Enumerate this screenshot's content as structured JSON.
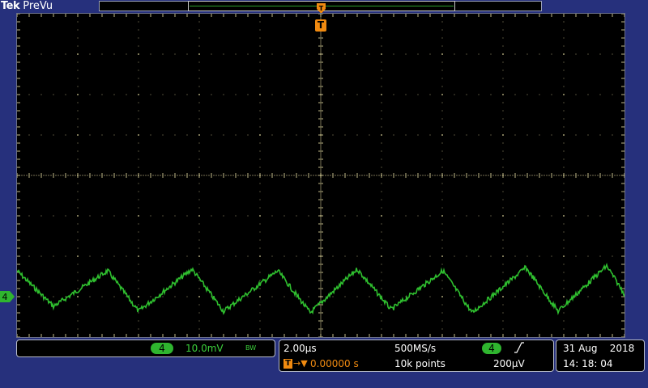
{
  "header": {
    "brand_tek": "Tek",
    "brand_mode": "PreVu"
  },
  "display": {
    "grid_color": "#c4bd8a",
    "trace_color": "#2fbf2f",
    "trigger_color": "#f08a10"
  },
  "trigger_marker": {
    "label": "T"
  },
  "channel": {
    "id": "4",
    "scale": "10.0mV",
    "bandwidth_icon": "BW"
  },
  "timebase": {
    "scale": "2.00µs",
    "trigger_icon_label": "T",
    "trigger_arrow": "→▼",
    "trigger_delay": "0.00000 s",
    "sample_rate": "500MS/s",
    "record_length": "10k points",
    "trigger_source": "4",
    "trigger_slope_icon": "rising-edge-icon",
    "trigger_level": "200µV"
  },
  "datetime": {
    "date": "31 Aug    2018",
    "time": "14: 18: 04"
  }
}
